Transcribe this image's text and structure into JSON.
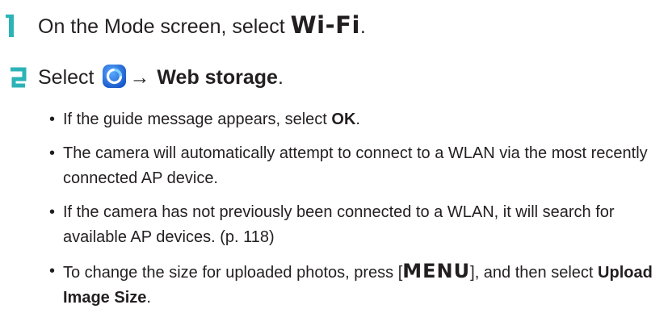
{
  "steps": [
    {
      "number": "1",
      "text_before": "On the Mode screen, select ",
      "highlight": "Wi-Fi",
      "text_after": "."
    },
    {
      "number": "2",
      "text_before": "Select ",
      "icon": "web-storage-circle-icon",
      "arrow": "→",
      "bold": "Web storage",
      "text_after": "."
    }
  ],
  "bullets": [
    {
      "parts": [
        {
          "text": "If the guide message appears, select "
        },
        {
          "text": "OK",
          "bold": true
        },
        {
          "text": "."
        }
      ]
    },
    {
      "parts": [
        {
          "text": "The camera will automatically attempt to connect to a WLAN via the most recently connected AP device."
        }
      ]
    },
    {
      "parts": [
        {
          "text": "If the camera has not previously been connected to a WLAN, it will search for available AP devices. (p. 118)"
        }
      ]
    },
    {
      "parts": [
        {
          "text": "To change the size for uploaded photos, press ["
        },
        {
          "text": "MENU",
          "menu": true
        },
        {
          "text": "], and then select "
        },
        {
          "text": "Upload Image Size",
          "bold": true
        },
        {
          "text": "."
        }
      ]
    }
  ],
  "bullet_char": "•",
  "colors": {
    "step_number": "#2bb3b7",
    "text": "#231f20",
    "icon_blue": "#1e6fd9"
  }
}
